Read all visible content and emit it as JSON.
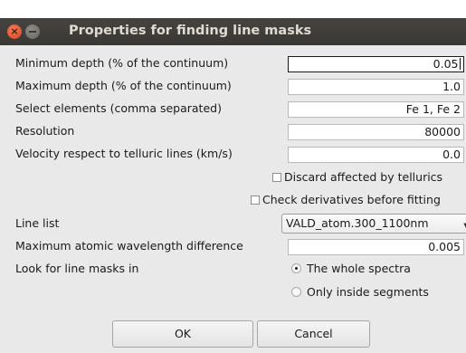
{
  "window": {
    "title": "Properties for finding line masks",
    "close_glyph": "×"
  },
  "fields": [
    {
      "label": "Minimum depth (% of the continuum)",
      "value": "0.05"
    },
    {
      "label": "Maximum depth (% of the continuum)",
      "value": "1.0"
    },
    {
      "label": "Select elements (comma separated)",
      "value": "Fe 1, Fe 2"
    },
    {
      "label": "Resolution",
      "value": "80000"
    },
    {
      "label": "Velocity respect to telluric lines (km/s)",
      "value": "0.0"
    }
  ],
  "checkboxes": {
    "discard_tellurics": {
      "label": "Discard affected by tellurics",
      "checked": false
    },
    "check_derivatives": {
      "label": "Check derivatives before fitting",
      "checked": false
    }
  },
  "line_list": {
    "label": "Line list",
    "selected": "VALD_atom.300_1100nm"
  },
  "max_wavelength_diff": {
    "label": "Maximum atomic wavelength difference",
    "value": "0.005"
  },
  "look_for": {
    "label": "Look for line masks in",
    "options": [
      {
        "label": "The whole spectra",
        "selected": true
      },
      {
        "label": "Only inside segments",
        "selected": false
      }
    ]
  },
  "buttons": {
    "ok": "OK",
    "cancel": "Cancel"
  }
}
